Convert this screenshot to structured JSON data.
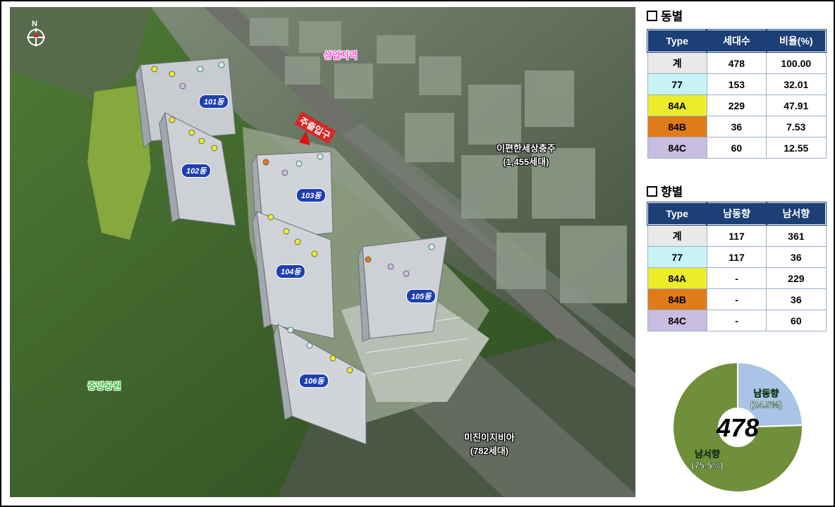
{
  "colors": {
    "header_bg": "#1c3f75",
    "total": "#e9e9e9",
    "t77": "#c7f3f6",
    "t84A": "#ecec2c",
    "t84B": "#e07b1a",
    "t84C": "#c8bde0",
    "pie_southeast": "#a9c4e4",
    "pie_southwest": "#6f8f3a"
  },
  "map": {
    "compass": "N",
    "commercial": "상업지역",
    "entrance": "주출입구",
    "neighbor1_name": "이편한세상충주",
    "neighbor1_units": "(1,455세대)",
    "neighbor2_name": "미진이지비아",
    "neighbor2_units": "(782세대)",
    "park": "중앙공원",
    "buildings": [
      "101동",
      "102동",
      "103동",
      "104동",
      "105동",
      "106동"
    ]
  },
  "by_building": {
    "title": "동별",
    "headers": [
      "Type",
      "세대수",
      "비율(%)"
    ],
    "rows": [
      {
        "type": "계",
        "units": "478",
        "ratio": "100.00",
        "color": "#e9e9e9"
      },
      {
        "type": "77",
        "units": "153",
        "ratio": "32.01",
        "color": "#c7f3f6"
      },
      {
        "type": "84A",
        "units": "229",
        "ratio": "47.91",
        "color": "#ecec2c"
      },
      {
        "type": "84B",
        "units": "36",
        "ratio": "7.53",
        "color": "#e07b1a"
      },
      {
        "type": "84C",
        "units": "60",
        "ratio": "12.55",
        "color": "#c8bde0"
      }
    ]
  },
  "by_direction": {
    "title": "향별",
    "headers": [
      "Type",
      "남동향",
      "남서향"
    ],
    "rows": [
      {
        "type": "계",
        "se": "117",
        "sw": "361",
        "color": "#e9e9e9"
      },
      {
        "type": "77",
        "se": "117",
        "sw": "36",
        "color": "#c7f3f6"
      },
      {
        "type": "84A",
        "se": "-",
        "sw": "229",
        "color": "#ecec2c"
      },
      {
        "type": "84B",
        "se": "-",
        "sw": "36",
        "color": "#e07b1a"
      },
      {
        "type": "84C",
        "se": "-",
        "sw": "60",
        "color": "#c8bde0"
      }
    ]
  },
  "chart_data": {
    "type": "pie",
    "center_label": "478",
    "slices": [
      {
        "label": "남동향",
        "pct_label": "(24.5%)",
        "value": 117,
        "percent": 24.5,
        "color": "#a9c4e4"
      },
      {
        "label": "남서향",
        "pct_label": "(75.5%)",
        "value": 361,
        "percent": 75.5,
        "color": "#6f8f3a"
      }
    ]
  }
}
